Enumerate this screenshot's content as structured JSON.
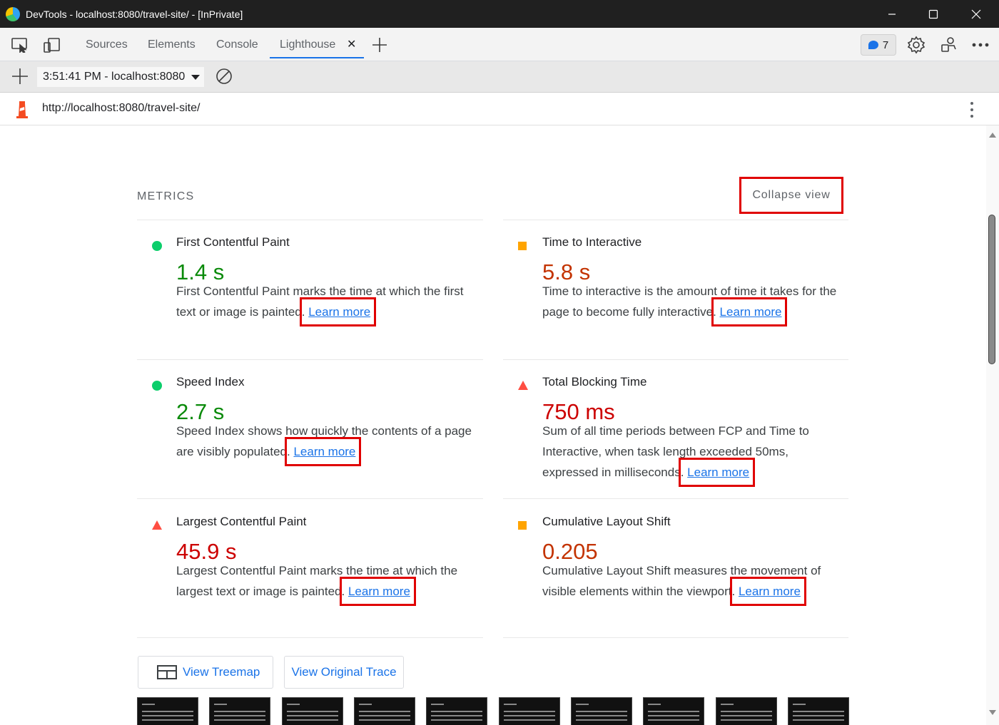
{
  "window": {
    "title": "DevTools - localhost:8080/travel-site/ - [InPrivate]"
  },
  "tabs": [
    {
      "label": "Sources"
    },
    {
      "label": "Elements"
    },
    {
      "label": "Console"
    },
    {
      "label": "Lighthouse"
    }
  ],
  "issues": {
    "count": "7"
  },
  "lh_toolbar": {
    "report_select": "3:51:41 PM - localhost:8080"
  },
  "urlbar": {
    "url": "http://localhost:8080/travel-site/"
  },
  "metrics": {
    "section_title": "METRICS",
    "collapse_label": "Collapse view",
    "learn_more": "Learn more",
    "items": [
      {
        "name": "First Contentful Paint",
        "value": "1.4 s",
        "rating": "pass",
        "desc": "First Contentful Paint marks the time at which the first text or image is painted."
      },
      {
        "name": "Time to Interactive",
        "value": "5.8 s",
        "rating": "average",
        "desc": "Time to interactive is the amount of time it takes for the page to become fully interactive."
      },
      {
        "name": "Speed Index",
        "value": "2.7 s",
        "rating": "pass",
        "desc": "Speed Index shows how quickly the contents of a page are visibly populated."
      },
      {
        "name": "Total Blocking Time",
        "value": "750 ms",
        "rating": "fail",
        "desc": "Sum of all time periods between FCP and Time to Interactive, when task length exceeded 50ms, expressed in milliseconds."
      },
      {
        "name": "Largest Contentful Paint",
        "value": "45.9 s",
        "rating": "fail",
        "desc": "Largest Contentful Paint marks the time at which the largest text or image is painted."
      },
      {
        "name": "Cumulative Layout Shift",
        "value": "0.205",
        "rating": "average",
        "desc": "Cumulative Layout Shift measures the movement of visible elements within the viewport."
      }
    ]
  },
  "actions": {
    "treemap_label": "View Treemap",
    "trace_label": "View Original Trace"
  },
  "colors": {
    "pass": "#0cce6b",
    "average": "#ffa400",
    "fail": "#ff4e42",
    "highlight": "#e00000",
    "link": "#1a73e8"
  }
}
